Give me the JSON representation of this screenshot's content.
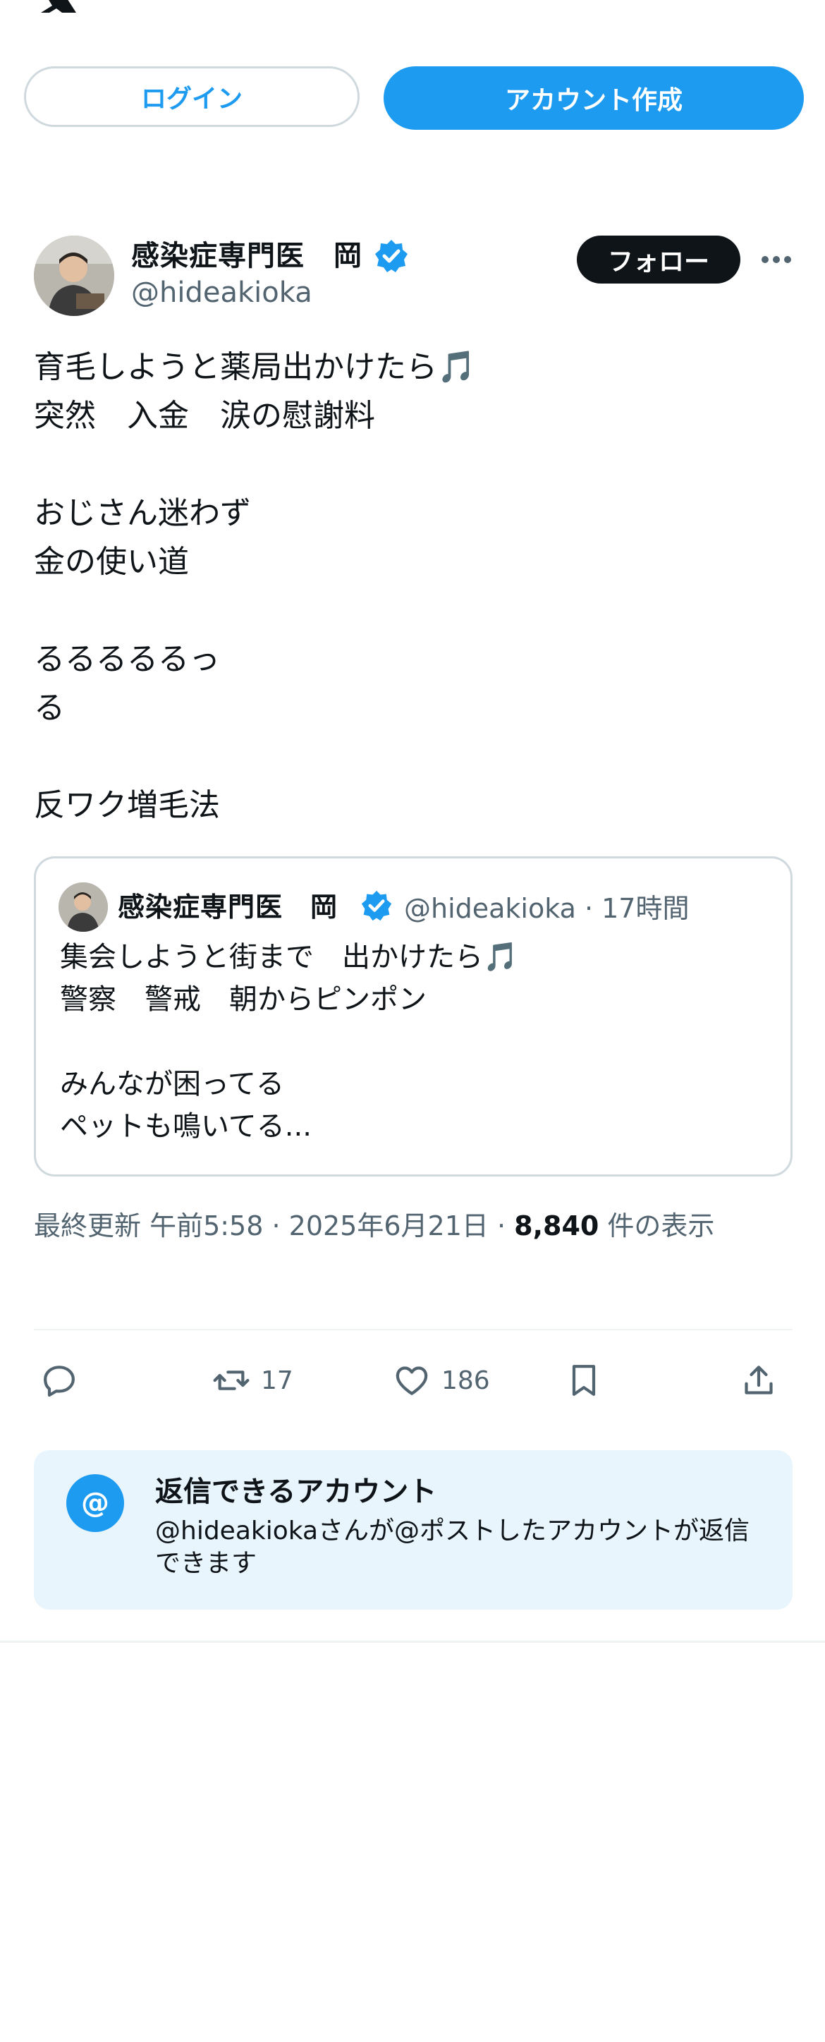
{
  "header": {
    "logo_icon": "x-logo-icon"
  },
  "auth": {
    "login_label": "ログイン",
    "signup_label": "アカウント作成"
  },
  "post": {
    "author_name": "感染症専門医　岡",
    "handle": "@hideakioka",
    "follow_label": "フォロー",
    "lines": [
      "育毛しようと薬局出かけたら🎵",
      "突然　入金　涙の慰謝料",
      "",
      "おじさん迷わず",
      "金の使い道",
      "",
      "るるるるるっ",
      "る",
      "",
      "反ワク増毛法"
    ]
  },
  "quote": {
    "author_name": "感染症専門医　岡",
    "handle_time": "@hideakioka · 17時間",
    "lines": [
      "集会しようと街まで　出かけたら🎵",
      "警察　警戒　朝からピンポン",
      "",
      "みんなが困ってる",
      "ペットも鳴いてる..."
    ]
  },
  "meta": {
    "updated_label": "最終更新 午前5:58 · 2025年6月21日 · ",
    "views": "8,840",
    "views_suffix": " 件の表示"
  },
  "actions": {
    "retweets": "17",
    "likes": "186"
  },
  "reply_settings": {
    "title": "返信できるアカウント",
    "description": "@hideakiokaさんが@ポストしたアカウントが返信できます",
    "at_symbol": "@"
  },
  "colors": {
    "accent": "#1d9bf0",
    "text": "#0f1419",
    "muted": "#536471",
    "border": "#cfd9de",
    "info_bg": "#e8f5fd"
  }
}
